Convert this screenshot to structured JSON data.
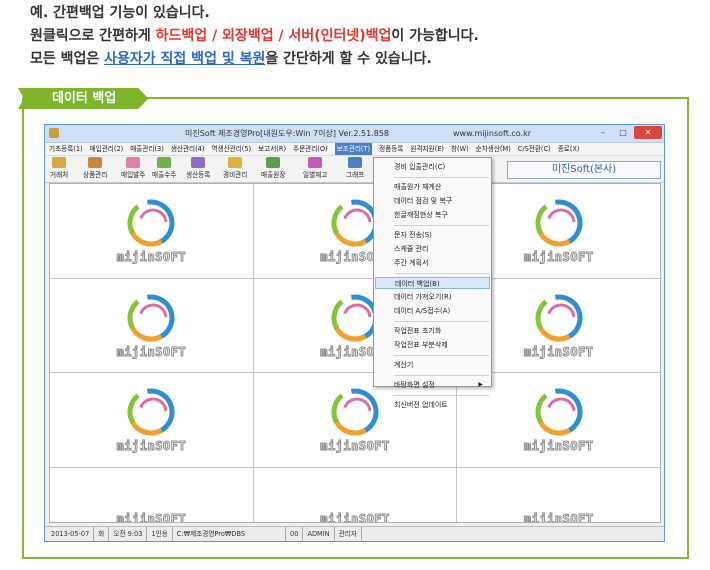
{
  "intro": {
    "line1": "예. 간편백업 기능이 있습니다.",
    "line2_a": "원클릭으로 간편하게 ",
    "line2_b": "하드백업 / 외장백업 / 서버(인터넷)백업",
    "line2_c": "이 가능합니다.",
    "line3_a": "모든 백업은 ",
    "line3_b": "사용자가 직접 백업 및 복원",
    "line3_c": "을 간단하게 할 수 있습니다."
  },
  "section_label": "데이터 백업",
  "window": {
    "title": "미진Soft 제조경영Pro[내원도우:Win 7이상] Ver.2.51.858",
    "url": "www.mijinsoft.co.kr",
    "minimize": "–",
    "maximize": "□",
    "close": "✕"
  },
  "menubar": [
    "기초등록(1)",
    "매입관리(2)",
    "매출관리(3)",
    "생산관리(4)",
    "역생산관리(5)",
    "보고서(R)",
    "주문관리(O)",
    "보조관리(T)",
    "정품등록",
    "원격지원(E)",
    "창(W)",
    "순차생산(M)",
    "C/S전환(C)",
    "종료(X)"
  ],
  "toolbar": [
    {
      "label": "거래처",
      "icon": "people-icon",
      "color": "#d9a83a"
    },
    {
      "label": "상품관리",
      "icon": "box-icon",
      "color": "#c9863a"
    },
    {
      "label": "매입발주",
      "icon": "cart-in-icon",
      "color": "#e07fa8"
    },
    {
      "label": "매출수주",
      "icon": "cart-out-icon",
      "color": "#6fb24b"
    },
    {
      "label": "생산등록",
      "icon": "gear-icon",
      "color": "#8e6cc2"
    },
    {
      "label": "경비관리",
      "icon": "coins-icon",
      "color": "#e0b13a"
    },
    {
      "label": "매출원장",
      "icon": "ledger-icon",
      "color": "#5aa04a"
    },
    {
      "label": "일별재고",
      "icon": "stock-icon",
      "color": "#c35ab7"
    },
    {
      "label": "그래프",
      "icon": "chart-icon",
      "color": "#4a7fc8"
    }
  ],
  "brand_box": "미진Soft(본사)",
  "watermark": "mijinSOFT",
  "dropdown": [
    {
      "label": "경비 입출관리(C)"
    },
    {
      "sep": true
    },
    {
      "label": "매출원가 재계산"
    },
    {
      "label": "데이터 점검 및 복구"
    },
    {
      "label": "한글깨짐현상 복구"
    },
    {
      "sep": true
    },
    {
      "label": "문자 전송(S)"
    },
    {
      "label": "스케쥴 관리"
    },
    {
      "label": "주간 계획서"
    },
    {
      "sep": true
    },
    {
      "label": "데이터 백업(B)",
      "highlight": true
    },
    {
      "label": "데이터 가져오기(R)"
    },
    {
      "label": "데이터 A/S접수(A)"
    },
    {
      "sep": true
    },
    {
      "label": "작업전표 초기화"
    },
    {
      "label": "작업전표 부분삭제"
    },
    {
      "sep": true
    },
    {
      "label": "계산기"
    },
    {
      "sep": true
    },
    {
      "label": "바탕화면 설정",
      "submenu": true
    },
    {
      "sep": true
    },
    {
      "label": "최신버전 업데이트"
    }
  ],
  "statusbar": [
    "2013-05-07",
    "화",
    "오전 9:03",
    "1인용",
    "C:₩제조경영Pro₩DBS",
    "00",
    "ADMIN",
    "관리자"
  ],
  "colors": {
    "accent_green": "#7fb52b",
    "highlight_red": "#e8342b",
    "link_blue": "#2d67c5"
  }
}
